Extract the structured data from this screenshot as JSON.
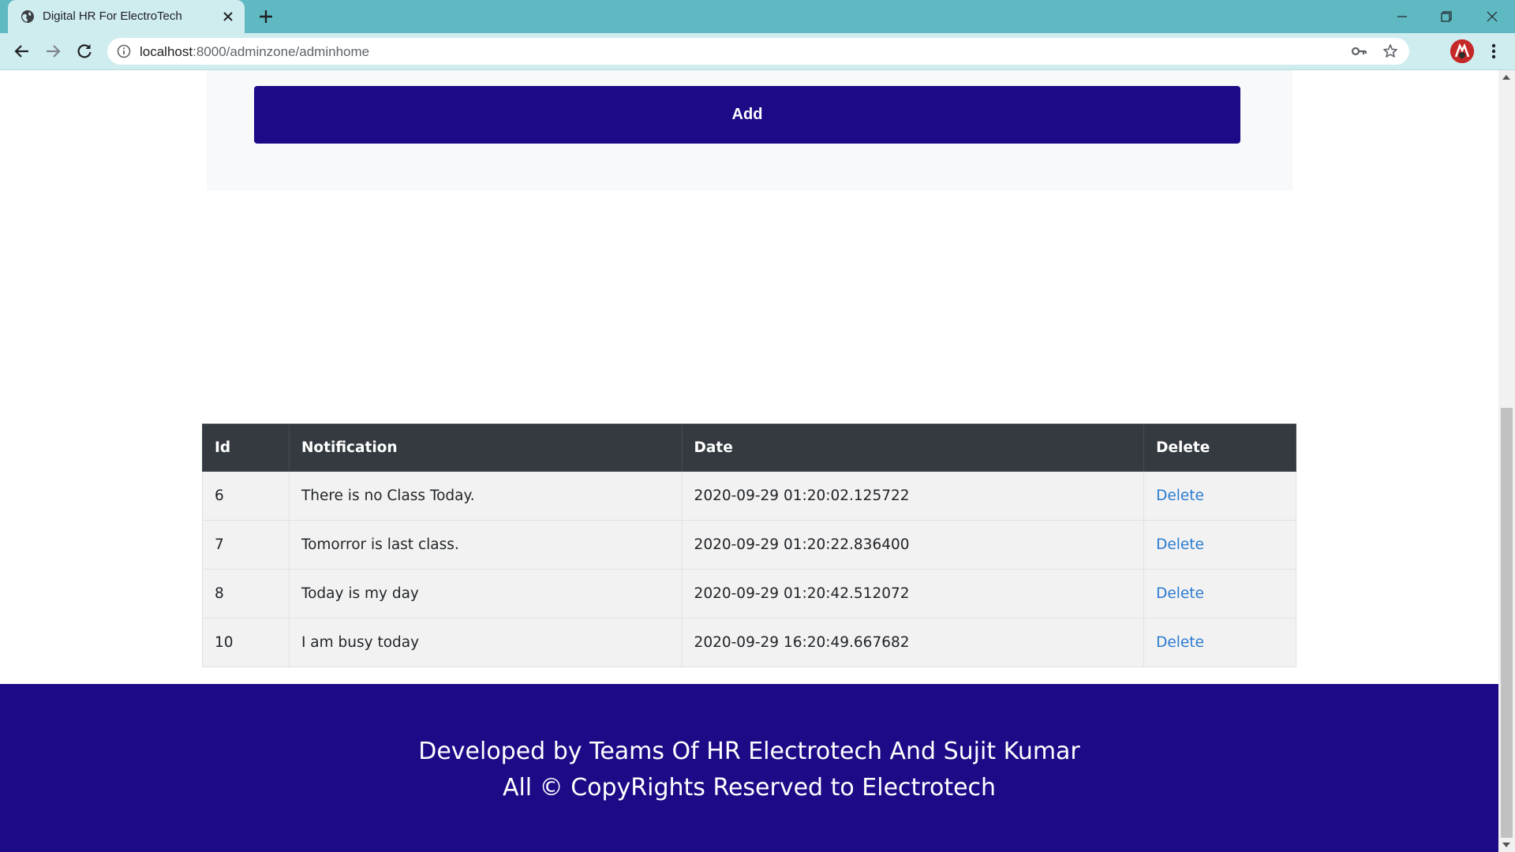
{
  "browser": {
    "tab_title": "Digital HR For ElectroTech",
    "url_host": "localhost",
    "url_rest": ":8000/adminzone/adminhome",
    "theme_color": "#5fb9c3"
  },
  "form": {
    "add_label": "Add"
  },
  "table": {
    "headers": [
      "Id",
      "Notification",
      "Date",
      "Delete"
    ],
    "rows": [
      {
        "id": "6",
        "notification": "There is no Class Today.",
        "date": "2020-09-29 01:20:02.125722",
        "action": "Delete"
      },
      {
        "id": "7",
        "notification": "Tomorror is last class.",
        "date": "2020-09-29 01:20:22.836400",
        "action": "Delete"
      },
      {
        "id": "8",
        "notification": "Today is my day",
        "date": "2020-09-29 01:20:42.512072",
        "action": "Delete"
      },
      {
        "id": "10",
        "notification": "I am busy today",
        "date": "2020-09-29 16:20:49.667682",
        "action": "Delete"
      }
    ]
  },
  "footer": {
    "line1": "Developed by Teams Of HR Electrotech And Sujit Kumar",
    "line2": "All © CopyRights Reserved to Electrotech"
  },
  "colors": {
    "primary": "#1c0a87",
    "table_header": "#343a40",
    "link": "#2a7bd1"
  },
  "icons": [
    "globe-icon",
    "close-icon",
    "plus-icon",
    "back-icon",
    "forward-icon",
    "reload-icon",
    "info-icon",
    "key-icon",
    "star-icon",
    "menu-icon"
  ]
}
